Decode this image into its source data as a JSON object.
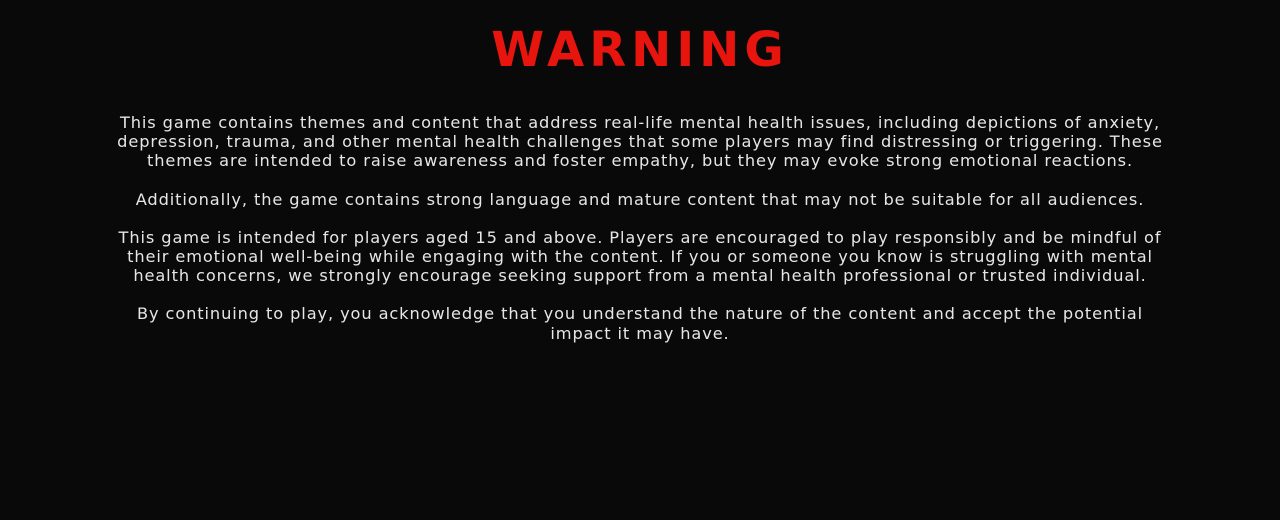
{
  "colors": {
    "background": "#0a090a",
    "title": "#e8140e",
    "text": "#e6e6e6"
  },
  "warning": {
    "title": "WARNING",
    "paragraphs": [
      "This game contains themes and content that address real-life mental health issues, including depictions of anxiety, depression, trauma, and other mental health challenges that some players may find distressing or triggering. These themes are intended to raise awareness and foster empathy, but they may evoke strong emotional reactions.",
      "Additionally, the game contains strong language and mature content that may not be suitable for all audiences.",
      "This game is intended for players aged 15 and above. Players are encouraged to play responsibly and be mindful of their emotional well-being while engaging with the content. If you or someone you know is struggling with mental health concerns, we strongly encourage seeking support from a mental health professional or trusted individual.",
      "By continuing to play, you acknowledge that you understand the nature of the content and accept the potential impact it may have."
    ]
  }
}
